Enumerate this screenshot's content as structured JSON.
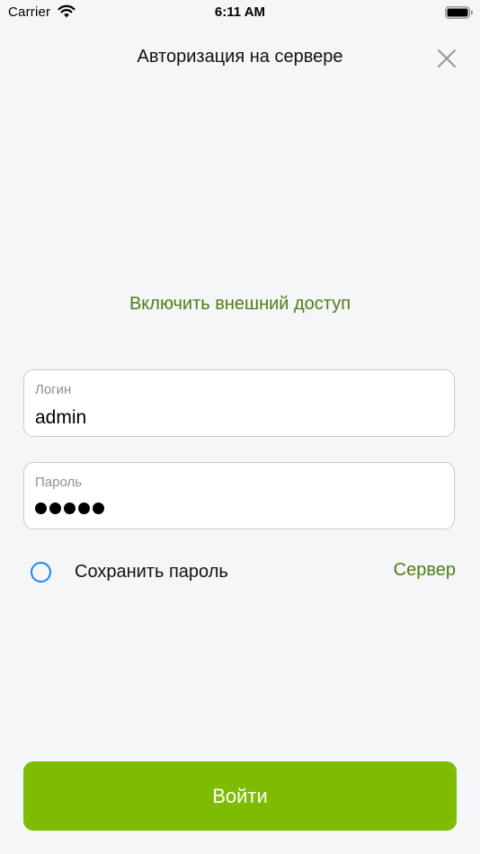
{
  "status_bar": {
    "carrier": "Carrier",
    "time": "6:11 AM"
  },
  "header": {
    "title": "Авторизация на сервере",
    "close_icon": "close-icon"
  },
  "external_access": {
    "label": "Включить внешний доступ"
  },
  "form": {
    "login": {
      "label": "Логин",
      "value": "admin"
    },
    "password": {
      "label": "Пароль",
      "masked_length": 5
    },
    "save_password": {
      "label": "Сохранить пароль",
      "checked": false
    },
    "server_link": "Сервер"
  },
  "submit": {
    "label": "Войти"
  },
  "colors": {
    "accent_green": "#7dbc00",
    "link_green": "#4f7d12",
    "radio_blue": "#1d86e6",
    "background": "#f5f6f8"
  }
}
